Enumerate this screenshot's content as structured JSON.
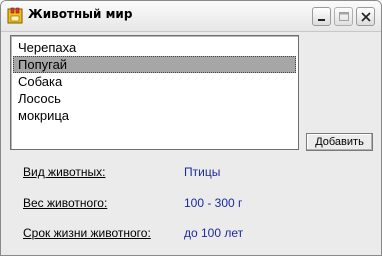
{
  "window": {
    "title": "Животный мир",
    "controls": {
      "minimize": "minimize-icon",
      "maximize": "maximize-icon",
      "close": "close-icon"
    }
  },
  "list": {
    "items": [
      "Черепаха",
      "Попугай",
      "Собака",
      "Лосось",
      "мокрица"
    ],
    "selected_index": 1
  },
  "buttons": {
    "add_label": "Добавить"
  },
  "details": {
    "type_label": "Вид животных:",
    "type_value": "Птицы",
    "weight_label": "Вес животного:",
    "weight_value": "100 - 300 г",
    "lifespan_label": "Срок жизни животного:",
    "lifespan_value": "до 100 лет"
  },
  "colors": {
    "value_text": "#1e2aa0",
    "selection": "#a6a6a6",
    "background": "#ebebeb"
  }
}
